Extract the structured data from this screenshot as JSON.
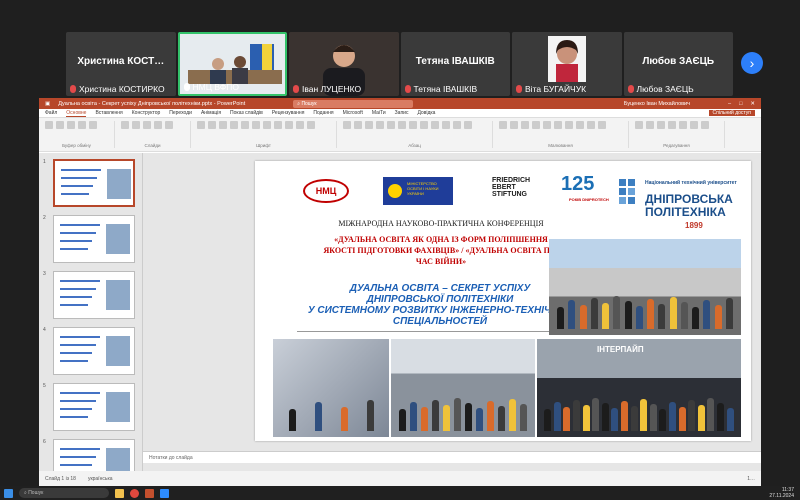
{
  "participants": [
    {
      "big_label": "Христина  КОСТ…",
      "name": "Христина КОСТИРКО",
      "active": false,
      "video": false
    },
    {
      "big_label": "",
      "name": "НМЦ ВФПО",
      "active": true,
      "video": true
    },
    {
      "big_label": "",
      "name": "Іван ЛУЦЕНКО",
      "active": false,
      "video": true
    },
    {
      "big_label": "Тетяна  ІВАШКІВ",
      "name": "Тетяна ІВАШКІВ",
      "active": false,
      "video": false
    },
    {
      "big_label": "",
      "name": "Віта БУГАЙЧУК",
      "active": false,
      "video": true
    },
    {
      "big_label": "Любов  ЗАЄЦЬ",
      "name": "Любов ЗАЄЦЬ",
      "active": false,
      "video": false
    }
  ],
  "strip_next_icon": "chevron-right-icon",
  "ppt": {
    "window_title": "Дуальна освіта - Секрет успіху Дніпровської політехніки.pptx  -  PowerPoint",
    "search_placeholder": "Пошук",
    "user_name": "Буценко Іван Михайлович",
    "tabs": [
      "Файл",
      "Основне",
      "Вставлення",
      "Конструктор",
      "Переходи",
      "Анімація",
      "Показ слайдів",
      "Рецензування",
      "Подання",
      "Microsoft",
      "МаіТи",
      "Запис",
      "Довідка"
    ],
    "selected_tab": "Основне",
    "share_label": "Спільний доступ",
    "ribbon_groups": [
      "Буфер обміну",
      "Слайди",
      "Шрифт",
      "Абзац",
      "Малювання",
      "Редагування"
    ],
    "notes_placeholder": "Нотатки до слайда",
    "status_slide": "Слайд 1 із 18",
    "status_lang": "українська",
    "zoom": "1…",
    "thumbnails": [
      1,
      2,
      3,
      4,
      5,
      6
    ]
  },
  "slide": {
    "logo_nmc": "НМЦ",
    "logo_mon": "МІНІСТЕРСТВО ОСВІТИ І НАУКИ УКРАЇНИ",
    "logo_fes_1": "FRIEDRICH",
    "logo_fes_2": "EBERT",
    "logo_fes_3": "STIFTUNG",
    "logo_125": "125",
    "logo_125_small": "РОКІВ DNIPROTECH",
    "dp_line1": "Національний технічний університет",
    "dp_line2a": "ДНІПРОВСЬКА",
    "dp_line2b": "ПОЛІТЕХНІКА",
    "dp_year": "1899",
    "conference": "МІЖНАРОДНА НАУКОВО-ПРАКТИЧНА КОНФЕРЕНЦІЯ",
    "topic_1": "«ДУАЛЬНА ОСВІТА ЯК ОДНА ІЗ ФОРМ ПОЛІПШЕННЯ",
    "topic_2": "ЯКОСТІ ПІДГОТОВКИ ФАХІВЦІВ» / «ДУАЛЬНА ОСВІТА ПІД",
    "topic_3": "ЧАС ВІЙНИ»",
    "title_1": "ДУАЛЬНА ОСВІТА – СЕКРЕТ УСПІХУ",
    "title_2": "ДНІПРОВСЬКОЇ ПОЛІТЕХНІКИ",
    "title_3": "У СИСТЕМНОМУ РОЗВИТКУ ІНЖЕНЕРНО-ТЕХНІЧНИХ",
    "title_4": "СПЕЦІАЛЬНОСТЕЙ",
    "photo4_label": "ІНТЕРПАЙП"
  },
  "taskbar": {
    "search_placeholder": "Пошук",
    "time": "11:37",
    "date": "27.11.2024"
  }
}
